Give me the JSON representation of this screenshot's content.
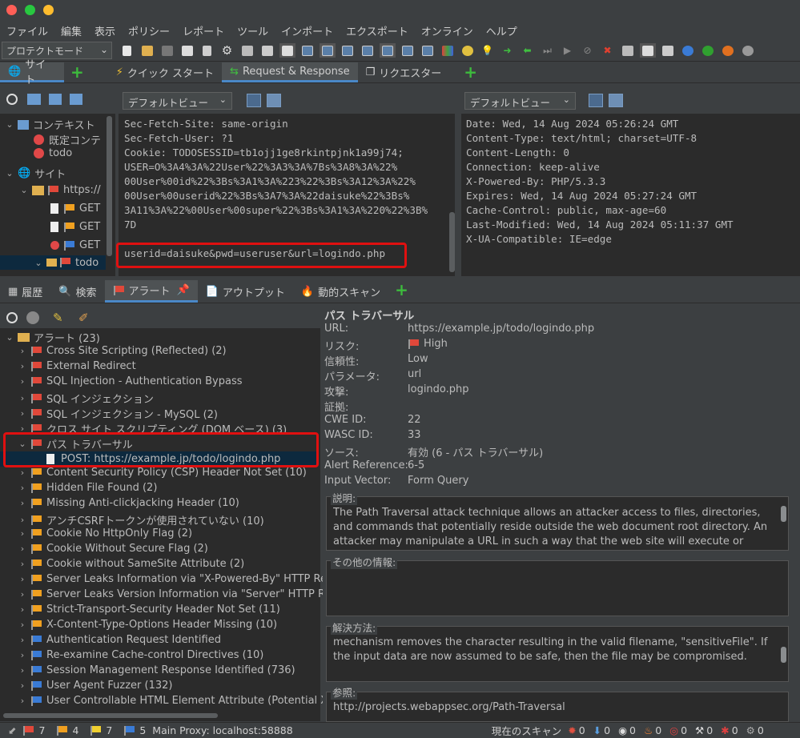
{
  "menu": [
    "ファイル",
    "編集",
    "表示",
    "ポリシー",
    "レポート",
    "ツール",
    "インポート",
    "エクスポート",
    "オンライン",
    "ヘルプ"
  ],
  "toolbar": {
    "mode": "プロテクトモード"
  },
  "top_tabs": {
    "site": "サイト",
    "quickstart": "クイック スタート",
    "reqresp": "Request & Response",
    "requester": "リクエスター"
  },
  "view_select": {
    "left": "デフォルトビュー",
    "right": "デフォルトビュー"
  },
  "site_tree": {
    "context": "コンテキスト",
    "default_context": "既定コンテ",
    "todo": "todo",
    "sites": "サイト",
    "https": "https://",
    "get1": "GET",
    "get2": "GET",
    "get3": "GET",
    "todo2": "todo"
  },
  "request_text": "Sec-Fetch-Site: same-origin\nSec-Fetch-User: ?1\nCookie: TODOSESSID=tb1ojj1ge8rkintpjnk1a99j74;\nUSER=O%3A4%3A%22User%22%3A3%3A%7Bs%3A8%3A%22%\n00User%00id%22%3Bs%3A1%3A%223%22%3Bs%3A12%3A%22%\n00User%00userid%22%3Bs%3A7%3A%22daisuke%22%3Bs%\n3A11%3A%22%00User%00super%22%3Bs%3A1%3A%220%22%3B%\n7D",
  "request_body": "userid=daisuke&pwd=useruser&url=logindo.php",
  "response_text": "Date: Wed, 14 Aug 2024 05:26:24 GMT\nContent-Type: text/html; charset=UTF-8\nContent-Length: 0\nConnection: keep-alive\nX-Powered-By: PHP/5.3.3\nExpires: Wed, 14 Aug 2024 05:27:24 GMT\nCache-Control: public, max-age=60\nLast-Modified: Wed, 14 Aug 2024 05:11:37 GMT\nX-UA-Compatible: IE=edge",
  "bottom_tabs": {
    "history": "履歴",
    "search": "検索",
    "alerts": "アラート",
    "output": "アウトプット",
    "active_scan": "動的スキャン"
  },
  "alerts": {
    "root": "アラート (23)",
    "items": [
      {
        "label": "Cross Site Scripting (Reflected) (2)",
        "flag": "red"
      },
      {
        "label": "External Redirect",
        "flag": "red"
      },
      {
        "label": "SQL Injection - Authentication Bypass",
        "flag": "red"
      },
      {
        "label": "SQL インジェクション",
        "flag": "red"
      },
      {
        "label": "SQL インジェクション - MySQL (2)",
        "flag": "red"
      },
      {
        "label": "クロス サイト スクリプティング (DOM ベース) (3)",
        "flag": "red"
      },
      {
        "label": "パス トラバーサル",
        "flag": "red"
      },
      {
        "label": "POST: https://example.jp/todo/logindo.php",
        "flag": "none"
      },
      {
        "label": "Content Security Policy (CSP) Header Not Set (10)",
        "flag": "orange"
      },
      {
        "label": "Hidden File Found (2)",
        "flag": "orange"
      },
      {
        "label": "Missing Anti-clickjacking Header (10)",
        "flag": "orange"
      },
      {
        "label": "アンチCSRFトークンが使用されていない (10)",
        "flag": "orange"
      },
      {
        "label": "Cookie No HttpOnly Flag (2)",
        "flag": "orange"
      },
      {
        "label": "Cookie Without Secure Flag (2)",
        "flag": "orange"
      },
      {
        "label": "Cookie without SameSite Attribute (2)",
        "flag": "orange"
      },
      {
        "label": "Server Leaks Information via \"X-Powered-By\" HTTP Re",
        "flag": "orange"
      },
      {
        "label": "Server Leaks Version Information via \"Server\" HTTP Re",
        "flag": "orange"
      },
      {
        "label": "Strict-Transport-Security Header Not Set (11)",
        "flag": "orange"
      },
      {
        "label": "X-Content-Type-Options Header Missing (10)",
        "flag": "orange"
      },
      {
        "label": "Authentication Request Identified",
        "flag": "blue"
      },
      {
        "label": "Re-examine Cache-control Directives (10)",
        "flag": "blue"
      },
      {
        "label": "Session Management Response Identified (736)",
        "flag": "blue"
      },
      {
        "label": "User Agent Fuzzer (132)",
        "flag": "blue"
      },
      {
        "label": "User Controllable HTML Element Attribute (Potential X",
        "flag": "blue"
      }
    ]
  },
  "detail": {
    "title": "パス トラバーサル",
    "url_label": "URL:",
    "url": "https://example.jp/todo/logindo.php",
    "risk_label": "リスク:",
    "risk": "High",
    "confidence_label": "信頼性:",
    "confidence": "Low",
    "param_label": "パラメータ:",
    "param": "url",
    "attack_label": "攻撃:",
    "attack": "logindo.php",
    "evidence_label": "証拠:",
    "cwe_label": "CWE ID:",
    "cwe": "22",
    "wasc_label": "WASC ID:",
    "wasc": "33",
    "source_label": "ソース:",
    "source": "有効 (6 - パス トラバーサル)",
    "alertref_label": "Alert Reference:",
    "alertref": "6-5",
    "vector_label": "Input Vector:",
    "vector": "Form Query",
    "desc_title": "説明:",
    "desc": "The Path Traversal attack technique allows an attacker access to files, directories, and commands that potentially reside outside the web document root directory. An attacker may manipulate a URL in such a way that the web site will execute or reveal",
    "other_title": "その他の情報:",
    "solution_title": "解決方法:",
    "solution": "mechanism removes the character resulting in the valid filename, \"sensitiveFile\". If the input data are now assumed to be safe, then the file may be compromised.",
    "ref_title": "参照:",
    "ref": "http://projects.webappsec.org/Path-Traversal"
  },
  "status": {
    "red": "7",
    "orange": "4",
    "yellow": "7",
    "blue": "5",
    "proxy": "Main Proxy: localhost:58888",
    "scan_label": "現在のスキャン",
    "c1": "0",
    "c2": "0",
    "c3": "0",
    "c4": "0",
    "c5": "0",
    "c6": "0",
    "c7": "0",
    "c8": "0"
  }
}
